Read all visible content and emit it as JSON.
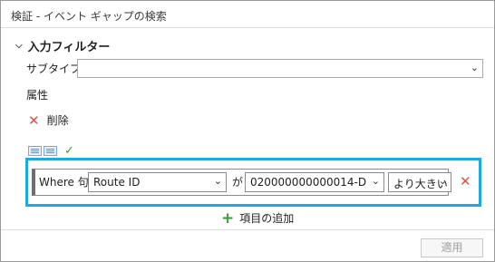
{
  "window": {
    "title": "検証 - イベント ギャップの検索"
  },
  "section": {
    "title": "入力フィルター"
  },
  "subtype": {
    "label": "サブタイプ",
    "value": ""
  },
  "attributes": {
    "label": "属性",
    "delete_label": "削除"
  },
  "clause": {
    "where_label": "Where 句",
    "field": "Route ID",
    "connector": "が",
    "value": "020000000000014-D",
    "operator": "より大きい"
  },
  "add_item_label": "項目の追加",
  "apply_label": "適用",
  "colors": {
    "highlight": "#1fa9de",
    "delete": "#d9534f",
    "add": "#3a9a3a"
  }
}
